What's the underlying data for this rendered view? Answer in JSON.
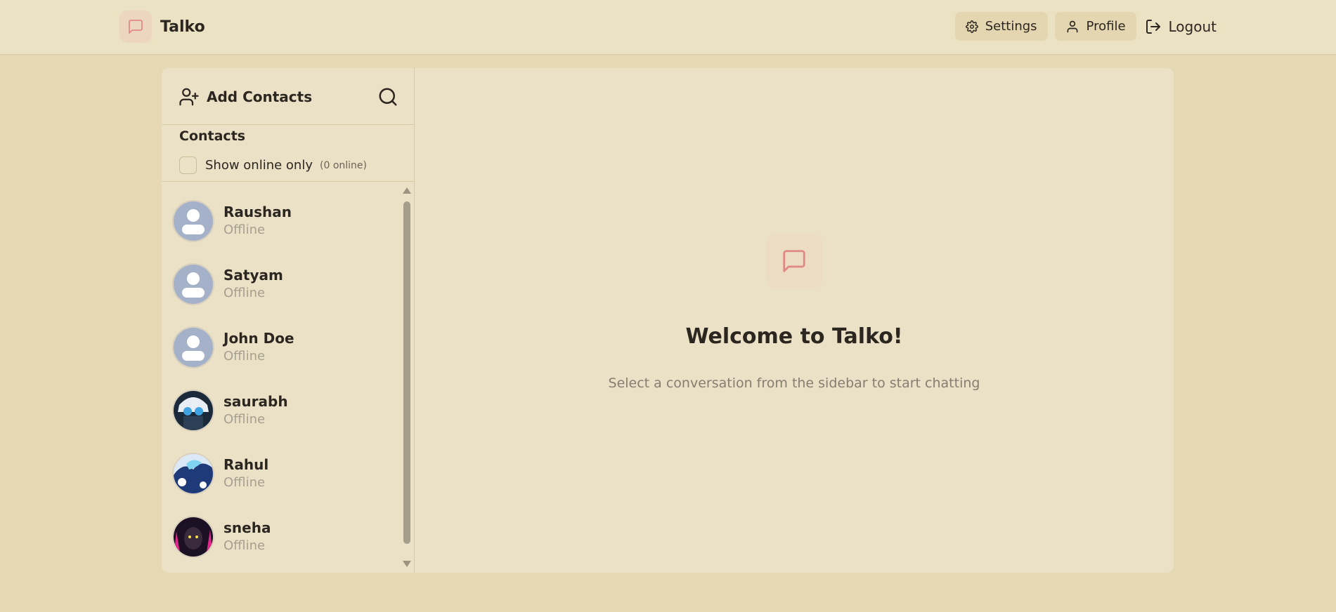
{
  "header": {
    "app_name": "Talko",
    "logo_icon": "message-square-icon",
    "nav": {
      "settings_label": "Settings",
      "profile_label": "Profile",
      "logout_label": "Logout"
    }
  },
  "sidebar": {
    "add_contacts_label": "Add Contacts",
    "contacts_title": "Contacts",
    "show_online_label": "Show online only",
    "online_count": "(0 online)",
    "show_online_checked": false,
    "contacts": [
      {
        "name": "Raushan",
        "status": "Offline",
        "avatar": "default"
      },
      {
        "name": "Satyam",
        "status": "Offline",
        "avatar": "default"
      },
      {
        "name": "John Doe",
        "status": "Offline",
        "avatar": "default"
      },
      {
        "name": "saurabh",
        "status": "Offline",
        "avatar": "photo-blue"
      },
      {
        "name": "Rahul",
        "status": "Offline",
        "avatar": "photo-ice"
      },
      {
        "name": "sneha",
        "status": "Offline",
        "avatar": "photo-pink"
      }
    ]
  },
  "welcome": {
    "title": "Welcome to Talko!",
    "subtitle": "Select a conversation from the sidebar to start chatting"
  },
  "colors": {
    "background": "#e5d8b2",
    "surface": "#ebe1c7",
    "accent": "#e08a86",
    "text": "#2b2620",
    "muted": "#a6a090"
  }
}
